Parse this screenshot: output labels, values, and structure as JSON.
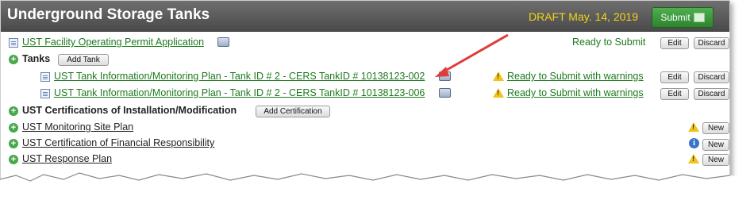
{
  "header": {
    "title": "Underground Storage Tanks",
    "draft": "DRAFT May. 14, 2019",
    "submit_label": "Submit"
  },
  "facility_permit": {
    "label": "UST Facility Operating Permit Application",
    "status": "Ready to Submit",
    "edit": "Edit",
    "discard": "Discard"
  },
  "tanks": {
    "label": "Tanks",
    "add_label": "Add Tank"
  },
  "tank_rows": [
    {
      "label": "UST Tank Information/Monitoring Plan - Tank ID # 2 - CERS TankID # 10138123-002",
      "status": "Ready to Submit with warnings",
      "edit": "Edit",
      "discard": "Discard"
    },
    {
      "label": "UST Tank Information/Monitoring Plan - Tank ID # 2 - CERS TankID # 10138123-006",
      "status": "Ready to Submit with warnings",
      "edit": "Edit",
      "discard": "Discard"
    }
  ],
  "certifications": {
    "label": "UST Certifications of Installation/Modification",
    "add_label": "Add Certification"
  },
  "sections": [
    {
      "label": "UST Monitoring Site Plan",
      "new": "New"
    },
    {
      "label": "UST Certification of Financial Responsibility",
      "new": "New"
    },
    {
      "label": "UST Response Plan",
      "new": "New"
    }
  ],
  "colors": {
    "link": "#1d7a1d",
    "header": "#5a5a5a",
    "draft": "#f2d31a",
    "arrow": "#e03c3c"
  }
}
